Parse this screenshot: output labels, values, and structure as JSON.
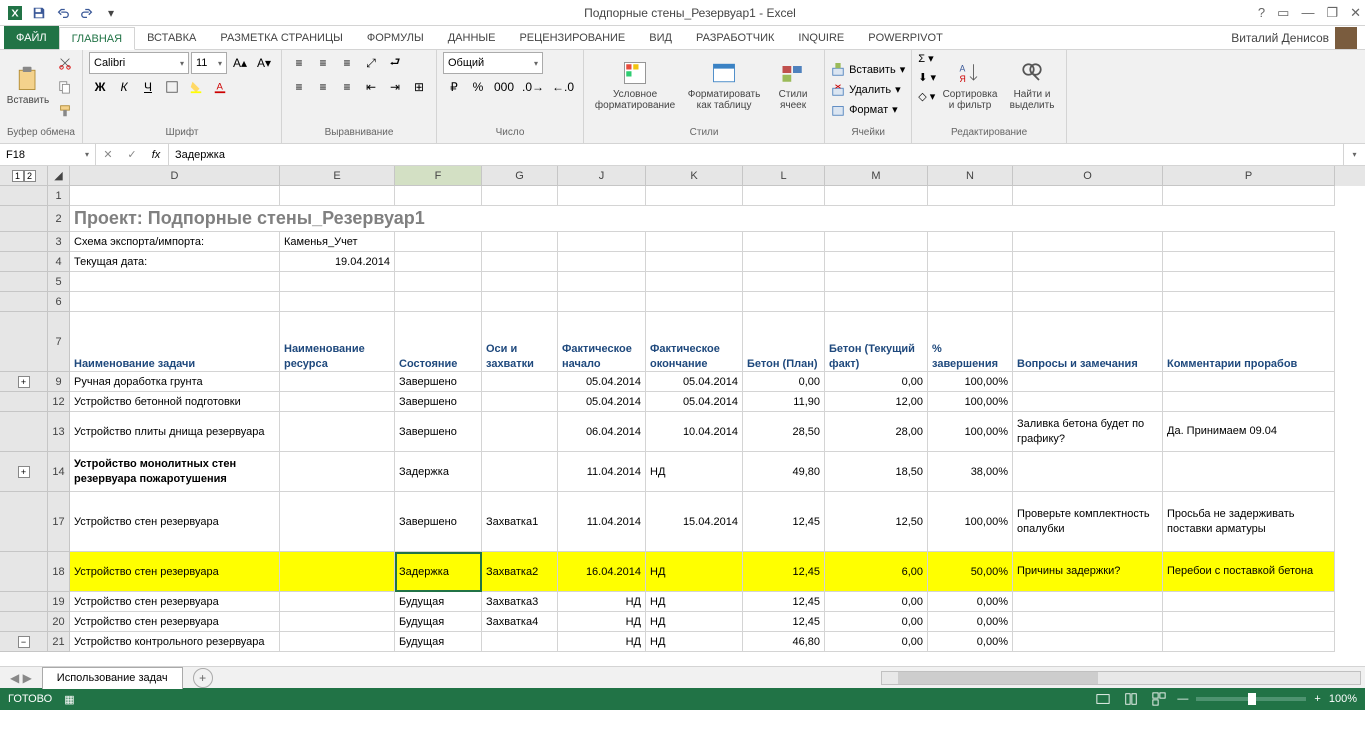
{
  "title": {
    "app": "Подпорные стены_Резервуар1 - Excel"
  },
  "tabs": {
    "file": "ФАЙЛ",
    "home": "ГЛАВНАЯ",
    "insert": "ВСТАВКА",
    "pagelayout": "РАЗМЕТКА СТРАНИЦЫ",
    "formulas": "ФОРМУЛЫ",
    "data": "ДАННЫЕ",
    "review": "РЕЦЕНЗИРОВАНИЕ",
    "view": "ВИД",
    "developer": "РАЗРАБОТЧИК",
    "inquire": "INQUIRE",
    "powerpivot": "POWERPIVOT"
  },
  "user": "Виталий Денисов",
  "ribbon": {
    "clipboard": {
      "paste": "Вставить",
      "label": "Буфер обмена"
    },
    "font": {
      "name": "Calibri",
      "size": "11",
      "label": "Шрифт"
    },
    "align": {
      "label": "Выравнивание"
    },
    "number": {
      "fmt": "Общий",
      "label": "Число"
    },
    "styles": {
      "cond": "Условное форматирование",
      "table": "Форматировать как таблицу",
      "cell": "Стили ячеек",
      "label": "Стили"
    },
    "cells": {
      "insert": "Вставить",
      "delete": "Удалить",
      "format": "Формат",
      "label": "Ячейки"
    },
    "edit": {
      "sort": "Сортировка и фильтр",
      "find": "Найти и выделить",
      "label": "Редактирование"
    }
  },
  "namebox": "F18",
  "formula": "Задержка",
  "cols": [
    "D",
    "E",
    "F",
    "G",
    "J",
    "K",
    "L",
    "M",
    "N",
    "O",
    "P"
  ],
  "sheet": {
    "title": "Проект: Подпорные стены_Резервуар1",
    "r3d": "Схема экспорта/импорта:",
    "r3e": "Каменья_Учет",
    "r4d": "Текущая дата:",
    "r4e": "19.04.2014",
    "h": {
      "D": "Наименование задачи",
      "E": "Наименование ресурса",
      "F": "Состояние",
      "G": "Оси и захватки",
      "J": "Фактическое начало",
      "K": "Фактическое окончание",
      "L": "Бетон (План)",
      "M": "Бетон (Текущий факт)",
      "N": "% завершения",
      "O": "Вопросы и замечания",
      "P": "Комментарии прорабов"
    },
    "rows": [
      {
        "n": 9,
        "d": "Ручная доработка грунта",
        "f": "Завершено",
        "j": "05.04.2014",
        "k": "05.04.2014",
        "l": "0,00",
        "m": "0,00",
        "np": "100,00%"
      },
      {
        "n": 12,
        "d": "Устройство бетонной подготовки",
        "f": "Завершено",
        "j": "05.04.2014",
        "k": "05.04.2014",
        "l": "11,90",
        "m": "12,00",
        "np": "100,00%"
      },
      {
        "n": 13,
        "d": "Устройство плиты днища резервуара",
        "f": "Завершено",
        "j": "06.04.2014",
        "k": "10.04.2014",
        "l": "28,50",
        "m": "28,00",
        "np": "100,00%",
        "o": "Заливка бетона будет по графику?",
        "p": "Да. Принимаем 09.04"
      },
      {
        "n": 14,
        "d": "Устройство монолитных стен резервуара пожаротушения",
        "bold": true,
        "f": "Задержка",
        "j": "11.04.2014",
        "k": "НД",
        "l": "49,80",
        "m": "18,50",
        "np": "38,00%"
      },
      {
        "n": 17,
        "d": "  Устройство стен резервуара",
        "f": "Завершено",
        "g": "Захватка1",
        "j": "11.04.2014",
        "k": "15.04.2014",
        "l": "12,45",
        "m": "12,50",
        "np": "100,00%",
        "o": "Проверьте комплектность опалубки",
        "p": "Просьба не задерживать поставки арматуры"
      },
      {
        "n": 18,
        "d": "  Устройство стен резервуара",
        "f": "Задержка",
        "g": "Захватка2",
        "j": "16.04.2014",
        "k": "НД",
        "l": "12,45",
        "m": "6,00",
        "np": "50,00%",
        "o": "Причины задержки?",
        "p": "Перебои с поставкой бетона",
        "yellow": true
      },
      {
        "n": 19,
        "d": "  Устройство стен резервуара",
        "f": "Будущая",
        "g": "Захватка3",
        "j": "НД",
        "k": "НД",
        "l": "12,45",
        "m": "0,00",
        "np": "0,00%"
      },
      {
        "n": 20,
        "d": "  Устройство стен резервуара",
        "f": "Будущая",
        "g": "Захватка4",
        "j": "НД",
        "k": "НД",
        "l": "12,45",
        "m": "0,00",
        "np": "0,00%"
      },
      {
        "n": 21,
        "d": " Устройство контрольного резервуара",
        "f": "Будущая",
        "j": "НД",
        "k": "НД",
        "l": "46,80",
        "m": "0,00",
        "np": "0,00%"
      }
    ]
  },
  "sheettab": "Использование задач",
  "status": {
    "ready": "ГОТОВО",
    "zoom": "100%"
  }
}
